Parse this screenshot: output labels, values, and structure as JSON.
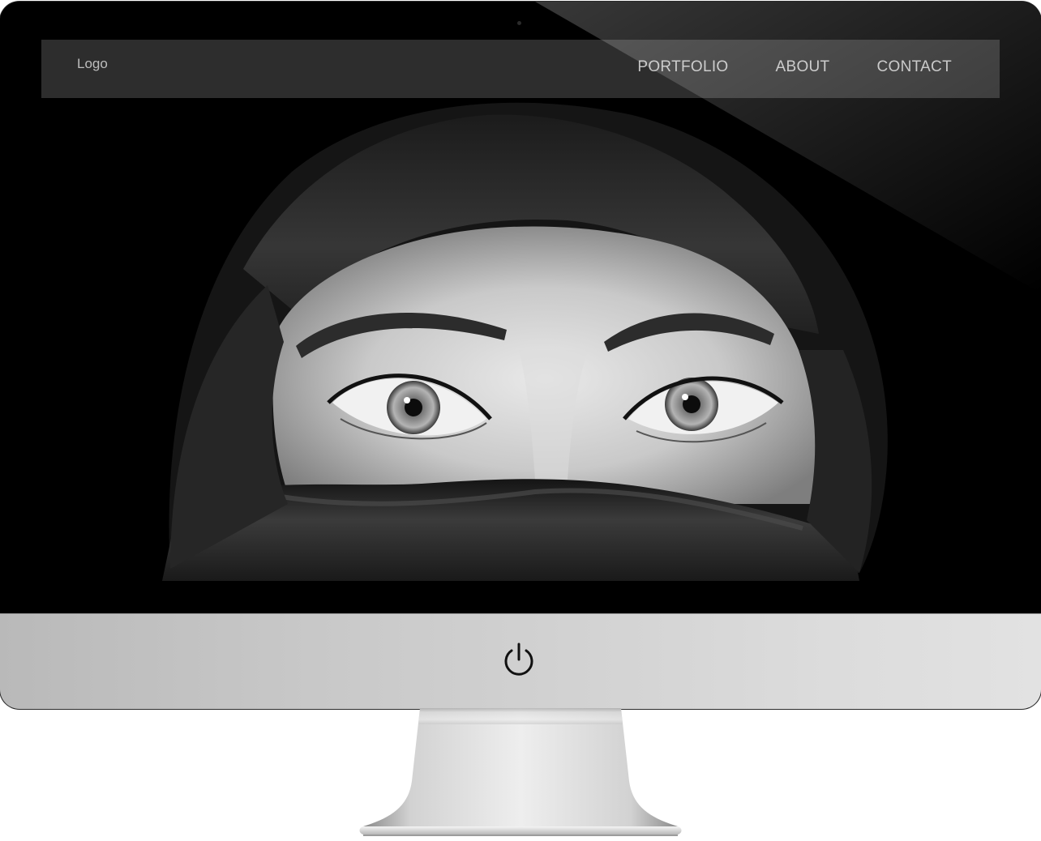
{
  "site": {
    "logo": "Logo",
    "nav": [
      {
        "label": "PORTFOLIO"
      },
      {
        "label": "ABOUT"
      },
      {
        "label": "CONTACT"
      }
    ]
  },
  "hero": {
    "image": "black-and-white portrait of a woman's eyes framed by a dark headscarf"
  },
  "device": {
    "power_icon": "power-icon",
    "frame_color": "#000000",
    "chin_color": "#cfcfcf"
  }
}
